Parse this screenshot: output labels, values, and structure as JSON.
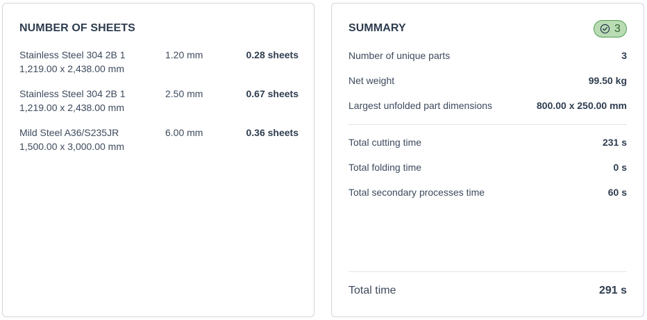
{
  "sheets": {
    "title": "NUMBER OF SHEETS",
    "items": [
      {
        "material": "Stainless Steel 304 2B 1",
        "dimensions": "1,219.00 x 2,438.00 mm",
        "thickness": "1.20 mm",
        "count": "0.28 sheets"
      },
      {
        "material": "Stainless Steel 304 2B 1",
        "dimensions": "1,219.00 x 2,438.00 mm",
        "thickness": "2.50 mm",
        "count": "0.67 sheets"
      },
      {
        "material": "Mild Steel A36/S235JR",
        "dimensions": "1,500.00 x 3,000.00 mm",
        "thickness": "6.00 mm",
        "count": "0.36 sheets"
      }
    ]
  },
  "summary": {
    "title": "SUMMARY",
    "badge": {
      "icon": "check-circle-icon",
      "count": "3",
      "color": "#b9dcb5",
      "border": "#4f9a4d"
    },
    "rows": [
      {
        "label": "Number of unique parts",
        "value": "3"
      },
      {
        "label": "Net weight",
        "value": "99.50 kg"
      },
      {
        "label": "Largest unfolded part dimensions",
        "value": "800.00 x 250.00 mm"
      }
    ],
    "time_rows": [
      {
        "label": "Total cutting time",
        "value": "231 s"
      },
      {
        "label": "Total folding time",
        "value": "0 s"
      },
      {
        "label": "Total secondary processes time",
        "value": "60 s"
      }
    ],
    "total": {
      "label": "Total time",
      "value": "291 s"
    }
  }
}
